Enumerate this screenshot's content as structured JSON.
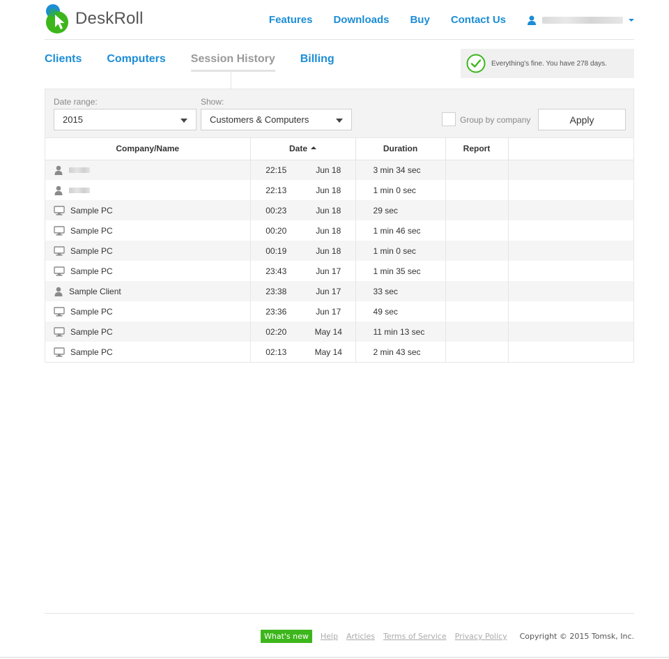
{
  "brand": {
    "name": "DeskRoll"
  },
  "topnav": {
    "items": [
      {
        "label": "Features"
      },
      {
        "label": "Downloads"
      },
      {
        "label": "Buy"
      },
      {
        "label": "Contact Us"
      }
    ]
  },
  "tabs": [
    {
      "label": "Clients"
    },
    {
      "label": "Computers"
    },
    {
      "label": "Session History",
      "active": true
    },
    {
      "label": "Billing"
    }
  ],
  "status": {
    "text": "Everything's fine. You have 278 days."
  },
  "filters": {
    "date_range_label": "Date range:",
    "date_range_value": "2015",
    "show_label": "Show:",
    "show_value": "Customers & Computers",
    "group_by_label": "Group by company",
    "group_by_checked": false,
    "apply_label": "Apply"
  },
  "table": {
    "headers": {
      "name": "Company/Name",
      "date": "Date",
      "duration": "Duration",
      "report": "Report"
    },
    "rows": [
      {
        "type": "client",
        "name": "",
        "time": "22:15",
        "date": "Jun 18",
        "duration": "3 min 34 sec"
      },
      {
        "type": "client",
        "name": "",
        "time": "22:13",
        "date": "Jun 18",
        "duration": "1 min 0 sec"
      },
      {
        "type": "computer",
        "name": "Sample PC",
        "time": "00:23",
        "date": "Jun 18",
        "duration": "29 sec"
      },
      {
        "type": "computer",
        "name": "Sample PC",
        "time": "00:20",
        "date": "Jun 18",
        "duration": "1 min 46 sec"
      },
      {
        "type": "computer",
        "name": "Sample PC",
        "time": "00:19",
        "date": "Jun 18",
        "duration": "1 min 0 sec"
      },
      {
        "type": "computer",
        "name": "Sample PC",
        "time": "23:43",
        "date": "Jun 17",
        "duration": "1 min 35 sec"
      },
      {
        "type": "client",
        "name": "Sample Client",
        "time": "23:38",
        "date": "Jun 17",
        "duration": "33 sec"
      },
      {
        "type": "computer",
        "name": "Sample PC",
        "time": "23:36",
        "date": "Jun 17",
        "duration": "49 sec"
      },
      {
        "type": "computer",
        "name": "Sample PC",
        "time": "02:20",
        "date": "May 14",
        "duration": "11 min 13 sec"
      },
      {
        "type": "computer",
        "name": "Sample PC",
        "time": "02:13",
        "date": "May 14",
        "duration": "2 min 43 sec"
      }
    ]
  },
  "footer": {
    "whats_new": "What's new",
    "links": [
      {
        "label": "Help"
      },
      {
        "label": "Articles"
      },
      {
        "label": "Terms of Service"
      },
      {
        "label": "Privacy Policy"
      }
    ],
    "copyright": "Copyright © 2015 Tomsk, Inc."
  },
  "colors": {
    "link_blue": "#1c8dd6",
    "status_green": "#3db61c",
    "inactive_tab": "#999999"
  },
  "icons": {
    "logo": "deskroll-logo-icon",
    "user": "user-icon",
    "status": "check-circle-icon",
    "client": "person-icon",
    "computer": "monitor-icon"
  }
}
